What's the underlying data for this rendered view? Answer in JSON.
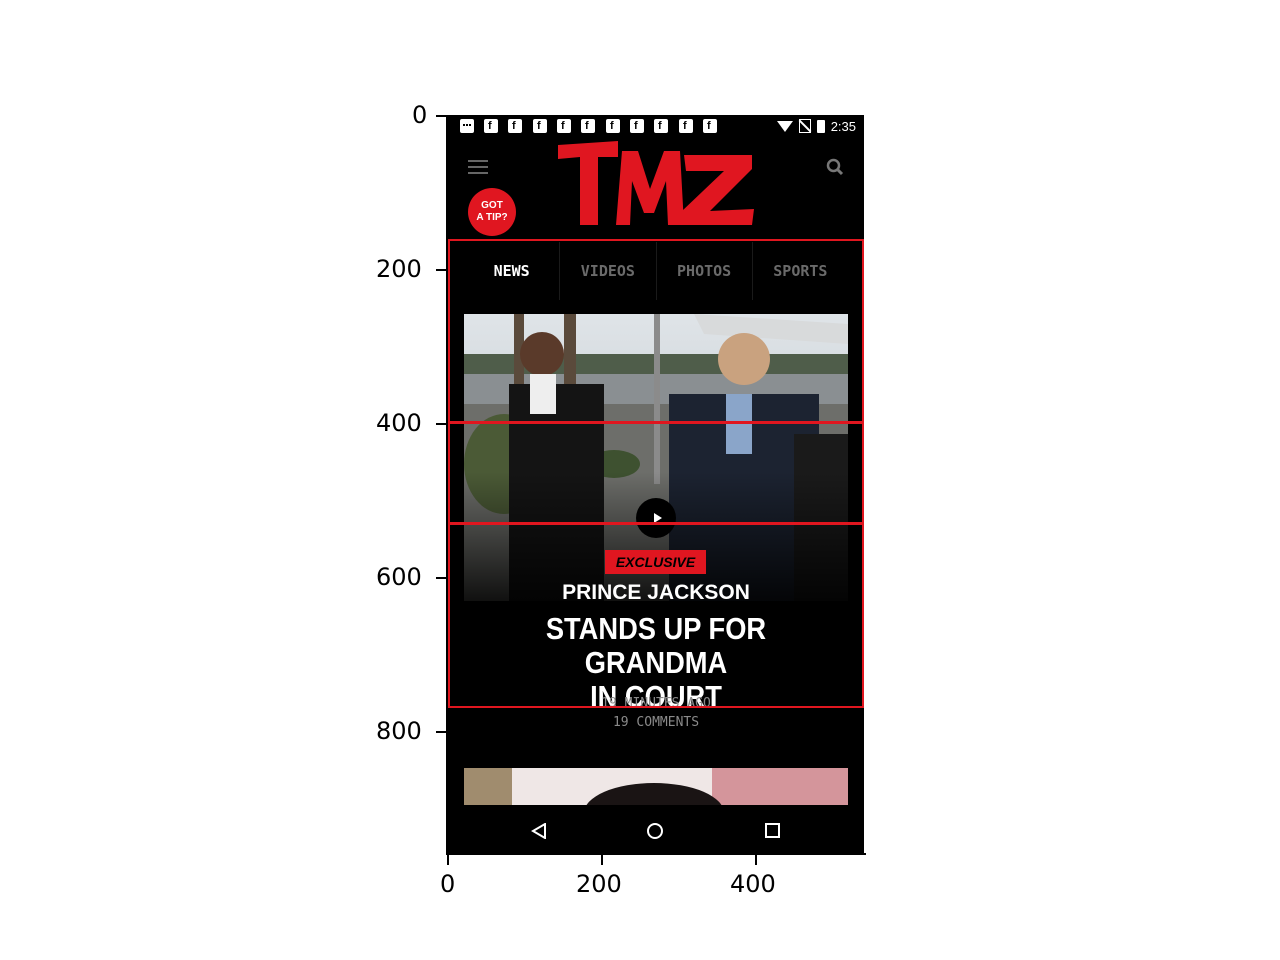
{
  "axes": {
    "y_ticks": [
      "0",
      "200",
      "400",
      "600",
      "800"
    ],
    "x_ticks": [
      "0",
      "200",
      "400"
    ]
  },
  "status_bar": {
    "time": "2:35",
    "notification_icons": [
      "message-icon",
      "facebook-icon",
      "facebook-icon",
      "facebook-icon",
      "facebook-icon",
      "facebook-icon",
      "facebook-icon",
      "facebook-icon",
      "facebook-icon",
      "facebook-icon",
      "facebook-icon"
    ]
  },
  "header": {
    "logo_text": "TMZ",
    "tip_badge_line1": "GOT",
    "tip_badge_line2": "A TIP?"
  },
  "tabs": [
    {
      "label": "NEWS",
      "active": true
    },
    {
      "label": "VIDEOS",
      "active": false
    },
    {
      "label": "PHOTOS",
      "active": false
    },
    {
      "label": "SPORTS",
      "active": false
    }
  ],
  "article": {
    "badge": "EXCLUSIVE",
    "kicker": "PRINCE JACKSON",
    "headline_line1": "STANDS UP FOR GRANDMA",
    "headline_line2": "IN COURT",
    "time": "19 MINUTES AGO",
    "comments": "19 COMMENTS"
  },
  "colors": {
    "brand_red": "#e01620",
    "background": "#000000",
    "annotation": "#e0161f"
  }
}
